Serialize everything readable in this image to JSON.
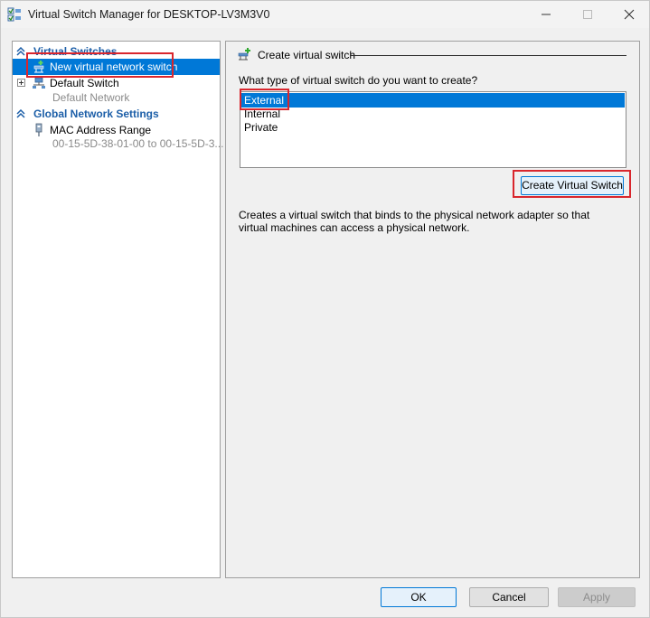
{
  "window": {
    "title": "Virtual Switch Manager for DESKTOP-LV3M3V0",
    "icon": "switch-manager-icon"
  },
  "tree": {
    "virtual_switches_header": "Virtual Switches",
    "new_switch_label": "New virtual network switch",
    "default_switch_label": "Default Switch",
    "default_switch_sub": "Default Network",
    "global_settings_header": "Global Network Settings",
    "mac_range_label": "MAC Address Range",
    "mac_range_sub": "00-15-5D-38-01-00 to 00-15-5D-3..."
  },
  "detail": {
    "header": "Create virtual switch",
    "question": "What type of virtual switch do you want to create?",
    "types": [
      "External",
      "Internal",
      "Private"
    ],
    "selected_type": "External",
    "create_button": "Create Virtual Switch",
    "description": "Creates a virtual switch that binds to the physical network adapter so that virtual machines can access a physical network."
  },
  "footer": {
    "ok": "OK",
    "cancel": "Cancel",
    "apply": "Apply"
  },
  "colors": {
    "selection": "#0078d7",
    "section_header": "#1d5fa8",
    "highlight_box": "#d9262d"
  }
}
